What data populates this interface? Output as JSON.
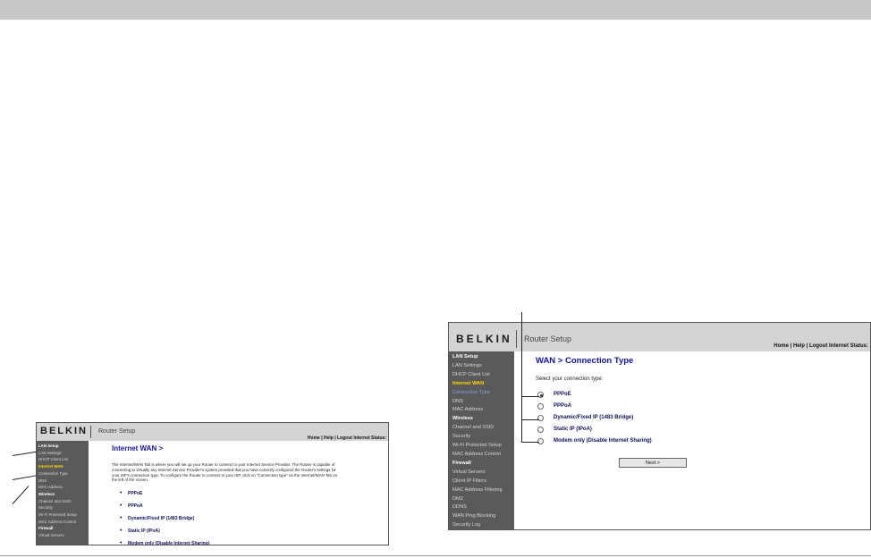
{
  "left_screen": {
    "logo": "BELKIN",
    "header_title": "Router Setup",
    "header_links": "Home | Help | Logout   Internet Status:",
    "sidebar": [
      {
        "label": "LAN Setup",
        "kind": "sec"
      },
      {
        "label": "LAN Settings",
        "kind": "item"
      },
      {
        "label": "DHCP Client List",
        "kind": "item"
      },
      {
        "label": "Internet WAN",
        "kind": "hl"
      },
      {
        "label": "Connection Type",
        "kind": "item"
      },
      {
        "label": "DNS",
        "kind": "item"
      },
      {
        "label": "MAC Address",
        "kind": "item"
      },
      {
        "label": "Wireless",
        "kind": "sec"
      },
      {
        "label": "Channel and SSID",
        "kind": "item"
      },
      {
        "label": "Security",
        "kind": "item"
      },
      {
        "label": "Wi-Fi Protected Setup",
        "kind": "item"
      },
      {
        "label": "MAC Address Control",
        "kind": "item"
      },
      {
        "label": "Firewall",
        "kind": "sec"
      },
      {
        "label": "Virtual Servers",
        "kind": "item"
      }
    ],
    "page_title": "Internet WAN >",
    "description": "The Internet/WAN Tab is where you will set up your Router to connect to your Internet Service Provider. The Router is capable of connecting to virtually any Internet Service Provider's system provided that you have correctly configured the Router's settings for your ISP's connection type. To configure the Router to connect to your ISP, click on \"Connection type\" on the Internet/WAN Tab on the left of the screen.",
    "options": [
      "PPPoE",
      "PPPoA",
      "Dynamic/Fixed IP (1483 Bridge)",
      "Static IP (IPoA)",
      "Modem only (Disable Internet Sharing)"
    ]
  },
  "right_screen": {
    "logo": "BELKIN",
    "header_title": "Router Setup",
    "header_links": "Home | Help | Logout   Internet Status:",
    "sidebar": [
      {
        "label": "LAN Setup",
        "kind": "sec"
      },
      {
        "label": "LAN Settings",
        "kind": "item"
      },
      {
        "label": "DHCP Client List",
        "kind": "item"
      },
      {
        "label": "Internet WAN",
        "kind": "hl"
      },
      {
        "label": "Connection Type",
        "kind": "hl2"
      },
      {
        "label": "DNS",
        "kind": "item"
      },
      {
        "label": "MAC Address",
        "kind": "item"
      },
      {
        "label": "Wireless",
        "kind": "sec"
      },
      {
        "label": "Channel and SSID",
        "kind": "item"
      },
      {
        "label": "Security",
        "kind": "item"
      },
      {
        "label": "Wi-Fi Protected Setup",
        "kind": "item"
      },
      {
        "label": "MAC Address Control",
        "kind": "item"
      },
      {
        "label": "Firewall",
        "kind": "sec"
      },
      {
        "label": "Virtual Servers",
        "kind": "item"
      },
      {
        "label": "Client IP Filters",
        "kind": "item"
      },
      {
        "label": "MAC Address Filtering",
        "kind": "item"
      },
      {
        "label": "DMZ",
        "kind": "item"
      },
      {
        "label": "DDNS",
        "kind": "item"
      },
      {
        "label": "WAN Ping Blocking",
        "kind": "item"
      },
      {
        "label": "Security Log",
        "kind": "item"
      }
    ],
    "page_title": "WAN > Connection Type",
    "prompt": "Select your connection type:",
    "options": [
      "PPPoE",
      "PPPoA",
      "Dynamic/Fixed IP (1483 Bridge)",
      "Static IP (IPoA)",
      "Modem only (Disable Internet Sharing)"
    ],
    "selected_index": 0,
    "next_label": "Next >"
  }
}
